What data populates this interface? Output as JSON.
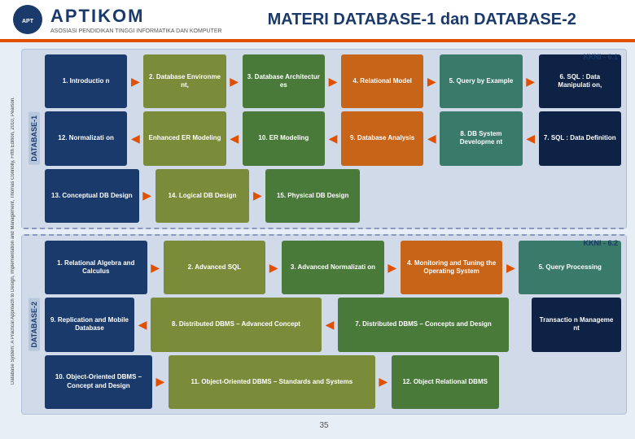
{
  "header": {
    "logo_text": "APTIKOM",
    "logo_sub": "ASOSIASI PENDIDIKAN TINGGI INFORMATIKA DAN KOMPUTER",
    "title": "MATERI DATABASE-1 dan DATABASE-2"
  },
  "side_label": "Database System: A Practical Approach to Design, Implementation and Management, Thomas Connolly, Fifth Edition, 2010, Pearson.",
  "section1": {
    "kkni": "KKNI - 6.1",
    "db_label": "DATABASE-1",
    "row1": [
      {
        "text": "1. Introductio n",
        "color": "dark-blue"
      },
      {
        "text": "2. Database Environme nt,",
        "color": "olive"
      },
      {
        "text": "3. Database Architectur es",
        "color": "green"
      },
      {
        "text": "4. Relational Model",
        "color": "orange"
      },
      {
        "text": "5. Query by Example",
        "color": "teal"
      },
      {
        "text": "6. SQL : Data Manipulati on,",
        "color": "dark-navy"
      }
    ],
    "row2": [
      {
        "text": "12. Normalizati on",
        "color": "dark-blue"
      },
      {
        "text": "Enhanced ER Modeling",
        "color": "olive"
      },
      {
        "text": "10. ER Modeling",
        "color": "green"
      },
      {
        "text": "9. Database Analysis",
        "color": "orange"
      },
      {
        "text": "8. DB System Developme nt",
        "color": "teal"
      },
      {
        "text": "7. SQL : Data Definition",
        "color": "dark-navy"
      }
    ],
    "row3": [
      {
        "text": "13. Conceptual DB Design",
        "color": "dark-blue"
      },
      {
        "text": "14. Logical DB Design",
        "color": "olive"
      },
      {
        "text": "15. Physical DB Design",
        "color": "green"
      }
    ]
  },
  "section2": {
    "kkni": "KKNI - 6.2",
    "db_label": "DATABASE-2",
    "row1": [
      {
        "text": "1. Relational Algebra and Calculus",
        "color": "dark-blue"
      },
      {
        "text": "2. Advanced SQL",
        "color": "olive"
      },
      {
        "text": "3. Advanced Normalizati on",
        "color": "green"
      },
      {
        "text": "4. Monitoring and Tuning the Operating System",
        "color": "orange"
      },
      {
        "text": "5. Query Processing",
        "color": "teal"
      }
    ],
    "row2": [
      {
        "text": "9. Replication and Mobile Database",
        "color": "dark-blue"
      },
      {
        "text": "8. Distributed DBMS – Advanced Concept",
        "color": "olive"
      },
      {
        "text": "7. Distributed DBMS – Concepts and Design",
        "color": "green"
      },
      {
        "text": "Transactio n Manageme nt",
        "color": "dark-navy"
      }
    ],
    "row3": [
      {
        "text": "10. Object-Oriented DBMS – Concept and Design",
        "color": "dark-blue"
      },
      {
        "text": "11. Object-Oriented DBMS – Standards and Systems",
        "color": "olive"
      },
      {
        "text": "12. Object Relational DBMS",
        "color": "green"
      }
    ]
  },
  "footer": {
    "page_number": "35"
  }
}
